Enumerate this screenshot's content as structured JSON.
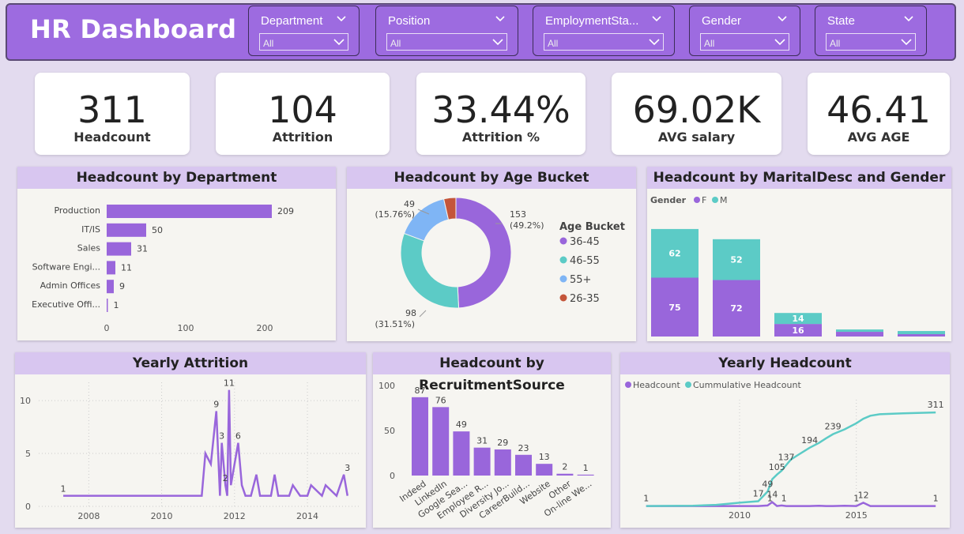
{
  "header": {
    "title": "HR Dashboard"
  },
  "slicers": [
    {
      "label": "Department",
      "value": "All"
    },
    {
      "label": "Position",
      "value": "All"
    },
    {
      "label": "EmploymentSta...",
      "value": "All"
    },
    {
      "label": "Gender",
      "value": "All"
    },
    {
      "label": "State",
      "value": "All"
    }
  ],
  "kpis": [
    {
      "value": "311",
      "label": "Headcount"
    },
    {
      "value": "104",
      "label": "Attrition"
    },
    {
      "value": "33.44%",
      "label": "Attrition %"
    },
    {
      "value": "69.02K",
      "label": "AVG salary"
    },
    {
      "value": "46.41",
      "label": "AVG AGE"
    }
  ],
  "colors": {
    "purple": "#9966db",
    "teal": "#5ccbc6",
    "lightblue": "#7fb5f5",
    "rust": "#c4553a"
  },
  "chart_data": [
    {
      "id": "dept",
      "type": "bar",
      "title": "Headcount by Department",
      "categories": [
        "Production",
        "IT/IS",
        "Sales",
        "Software Engi...",
        "Admin Offices",
        "Executive Offi..."
      ],
      "values": [
        209,
        50,
        31,
        11,
        9,
        1
      ],
      "xticks": [
        0,
        100,
        200
      ],
      "xlim": [
        0,
        230
      ]
    },
    {
      "id": "age",
      "type": "pie",
      "title": "Headcount by Age Bucket",
      "legend_title": "Age Bucket",
      "slices": [
        {
          "name": "36-45",
          "value": 153,
          "pct": "(49.2%)",
          "color": "#9966db"
        },
        {
          "name": "46-55",
          "value": 98,
          "pct": "(31.51%)",
          "color": "#5ccbc6"
        },
        {
          "name": "55+",
          "value": 49,
          "pct": "(15.76%)",
          "color": "#7fb5f5"
        },
        {
          "name": "26-35",
          "value": 11,
          "pct": "",
          "color": "#c4553a"
        }
      ]
    },
    {
      "id": "marital",
      "type": "bar",
      "title": "Headcount by MaritalDesc and Gender",
      "legend_title": "Gender",
      "series": [
        {
          "name": "F",
          "values": [
            75,
            72,
            16,
            6,
            3
          ],
          "color": "#9966db"
        },
        {
          "name": "M",
          "values": [
            62,
            52,
            14,
            3,
            4
          ],
          "color": "#5ccbc6"
        }
      ],
      "labels_shown": [
        [
          75,
          72,
          16,
          null,
          null
        ],
        [
          62,
          52,
          14,
          null,
          null
        ]
      ],
      "ylim": [
        0,
        150
      ]
    },
    {
      "id": "attrition",
      "type": "line",
      "title": "Yearly Attrition",
      "x": [
        2007.3,
        2011.1,
        2011.2,
        2011.35,
        2011.5,
        2011.6,
        2011.65,
        2011.75,
        2011.8,
        2011.85,
        2011.9,
        2012.1,
        2012.2,
        2012.3,
        2012.45,
        2012.6,
        2012.7,
        2013.0,
        2013.1,
        2013.2,
        2013.5,
        2013.6,
        2013.8,
        2014.0,
        2014.1,
        2014.4,
        2014.5,
        2014.8,
        2015.0,
        2015.1
      ],
      "y": [
        1,
        1,
        5,
        4,
        9,
        1,
        6,
        2,
        1,
        11,
        2,
        6,
        2,
        1,
        1,
        3,
        1,
        1,
        3,
        1,
        1,
        2,
        1,
        1,
        2,
        1,
        2,
        1,
        3,
        1
      ],
      "point_labels": [
        {
          "x": 2007.3,
          "y": 1,
          "text": "1"
        },
        {
          "x": 2011.5,
          "y": 9,
          "text": "9"
        },
        {
          "x": 2011.85,
          "y": 11,
          "text": "11"
        },
        {
          "x": 2011.65,
          "y": 6,
          "text": "3"
        },
        {
          "x": 2011.75,
          "y": 2,
          "text": "2"
        },
        {
          "x": 2012.1,
          "y": 6,
          "text": "6"
        },
        {
          "x": 2015.1,
          "y": 3,
          "text": "3"
        }
      ],
      "xticks": [
        2008,
        2010,
        2012,
        2014
      ],
      "yticks": [
        0,
        5,
        10
      ],
      "xlim": [
        2006.8,
        2015.3
      ],
      "ylim": [
        0,
        11.5
      ]
    },
    {
      "id": "recruit",
      "type": "bar",
      "title": "Headcount by RecruitmentSource",
      "categories": [
        "Indeed",
        "LinkedIn",
        "Google Sea...",
        "Employee R...",
        "Diversity Jo...",
        "CareerBuild...",
        "Website",
        "Other",
        "On-line We..."
      ],
      "values": [
        87,
        76,
        49,
        31,
        29,
        23,
        13,
        2,
        1
      ],
      "yticks": [
        0,
        50,
        100
      ],
      "ylim": [
        0,
        100
      ]
    },
    {
      "id": "yearly",
      "type": "line",
      "title": "Yearly Headcount",
      "series": [
        {
          "name": "Headcount",
          "color": "#9966db"
        },
        {
          "name": "Cummulative Headcount",
          "color": "#5ccbc6"
        }
      ],
      "x": [
        2006,
        2008,
        2009,
        2010,
        2010.8,
        2011.2,
        2011.4,
        2011.6,
        2011.8,
        2012.0,
        2012.2,
        2012.5,
        2013.0,
        2013.4,
        2013.7,
        2014.0,
        2014.5,
        2015.0,
        2015.3,
        2015.6,
        2016,
        2017,
        2018.4
      ],
      "cumulative": [
        1,
        2,
        5,
        12,
        17,
        49,
        90,
        105,
        118,
        137,
        155,
        170,
        194,
        210,
        225,
        239,
        255,
        275,
        290,
        300,
        305,
        308,
        311
      ],
      "headcount": [
        1,
        1,
        1,
        1,
        1,
        3,
        14,
        1,
        3,
        1,
        1,
        1,
        1,
        2,
        1,
        1,
        2,
        1,
        12,
        1,
        1,
        1,
        1
      ],
      "point_labels": [
        {
          "series": "Cummulative Headcount",
          "x": 2006,
          "y": 1,
          "text": "1"
        },
        {
          "series": "Cummulative Headcount",
          "x": 2010.8,
          "y": 17,
          "text": "17"
        },
        {
          "series": "Cummulative Headcount",
          "x": 2011.2,
          "y": 49,
          "text": "49"
        },
        {
          "series": "Cummulative Headcount",
          "x": 2011.6,
          "y": 105,
          "text": "105"
        },
        {
          "series": "Cummulative Headcount",
          "x": 2012.0,
          "y": 137,
          "text": "137"
        },
        {
          "series": "Cummulative Headcount",
          "x": 2013.0,
          "y": 194,
          "text": "194"
        },
        {
          "series": "Cummulative Headcount",
          "x": 2014.0,
          "y": 239,
          "text": "239"
        },
        {
          "series": "Cummulative Headcount",
          "x": 2018.4,
          "y": 311,
          "text": "311"
        },
        {
          "series": "Headcount",
          "x": 2011.4,
          "y": 14,
          "text": "14"
        },
        {
          "series": "Headcount",
          "x": 2011.3,
          "y": 1,
          "text": "1"
        },
        {
          "series": "Headcount",
          "x": 2011.9,
          "y": 1,
          "text": "1"
        },
        {
          "series": "Headcount",
          "x": 2015.0,
          "y": 1,
          "text": "1"
        },
        {
          "series": "Headcount",
          "x": 2015.3,
          "y": 12,
          "text": "12"
        },
        {
          "series": "Headcount",
          "x": 2018.4,
          "y": 1,
          "text": "1"
        }
      ],
      "xticks": [
        2010,
        2015
      ],
      "xlim": [
        2005.5,
        2018.8
      ],
      "ylim": [
        0,
        340
      ]
    }
  ]
}
